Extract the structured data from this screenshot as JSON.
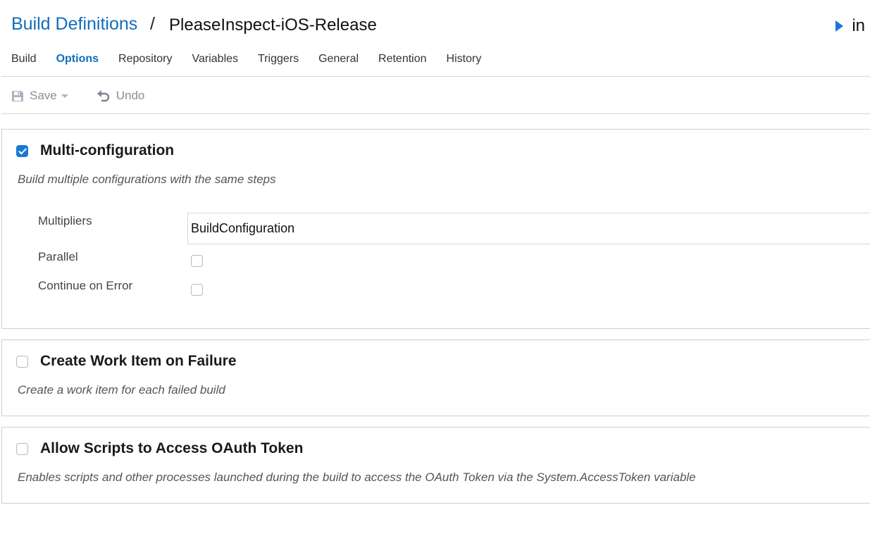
{
  "header": {
    "breadcrumb_link": "Build Definitions",
    "separator": "/",
    "title": "PleaseInspect-iOS-Release",
    "queue_label": "in",
    "queue_icon": "play-icon"
  },
  "tabs": [
    {
      "label": "Build",
      "active": false
    },
    {
      "label": "Options",
      "active": true
    },
    {
      "label": "Repository",
      "active": false
    },
    {
      "label": "Variables",
      "active": false
    },
    {
      "label": "Triggers",
      "active": false
    },
    {
      "label": "General",
      "active": false
    },
    {
      "label": "Retention",
      "active": false
    },
    {
      "label": "History",
      "active": false
    }
  ],
  "toolbar": {
    "save_label": "Save",
    "save_icon": "floppy-disk-icon",
    "undo_label": "Undo",
    "undo_icon": "undo-icon"
  },
  "sections": {
    "multi_config": {
      "title": "Multi-configuration",
      "checked": true,
      "description": "Build multiple configurations with the same steps",
      "multipliers_label": "Multipliers",
      "multipliers_value": "BuildConfiguration",
      "parallel_label": "Parallel",
      "parallel_checked": false,
      "continue_label": "Continue on Error",
      "continue_checked": false
    },
    "work_item": {
      "title": "Create Work Item on Failure",
      "checked": false,
      "description": "Create a work item for each failed build"
    },
    "oauth": {
      "title": "Allow Scripts to Access OAuth Token",
      "checked": false,
      "description": "Enables scripts and other processes launched during the build to access the OAuth Token via the System.AccessToken variable"
    }
  },
  "colors": {
    "accent": "#106ebe",
    "checkbox_checked": "#1a78d4",
    "toolbar_disabled": "#8a8f96"
  }
}
